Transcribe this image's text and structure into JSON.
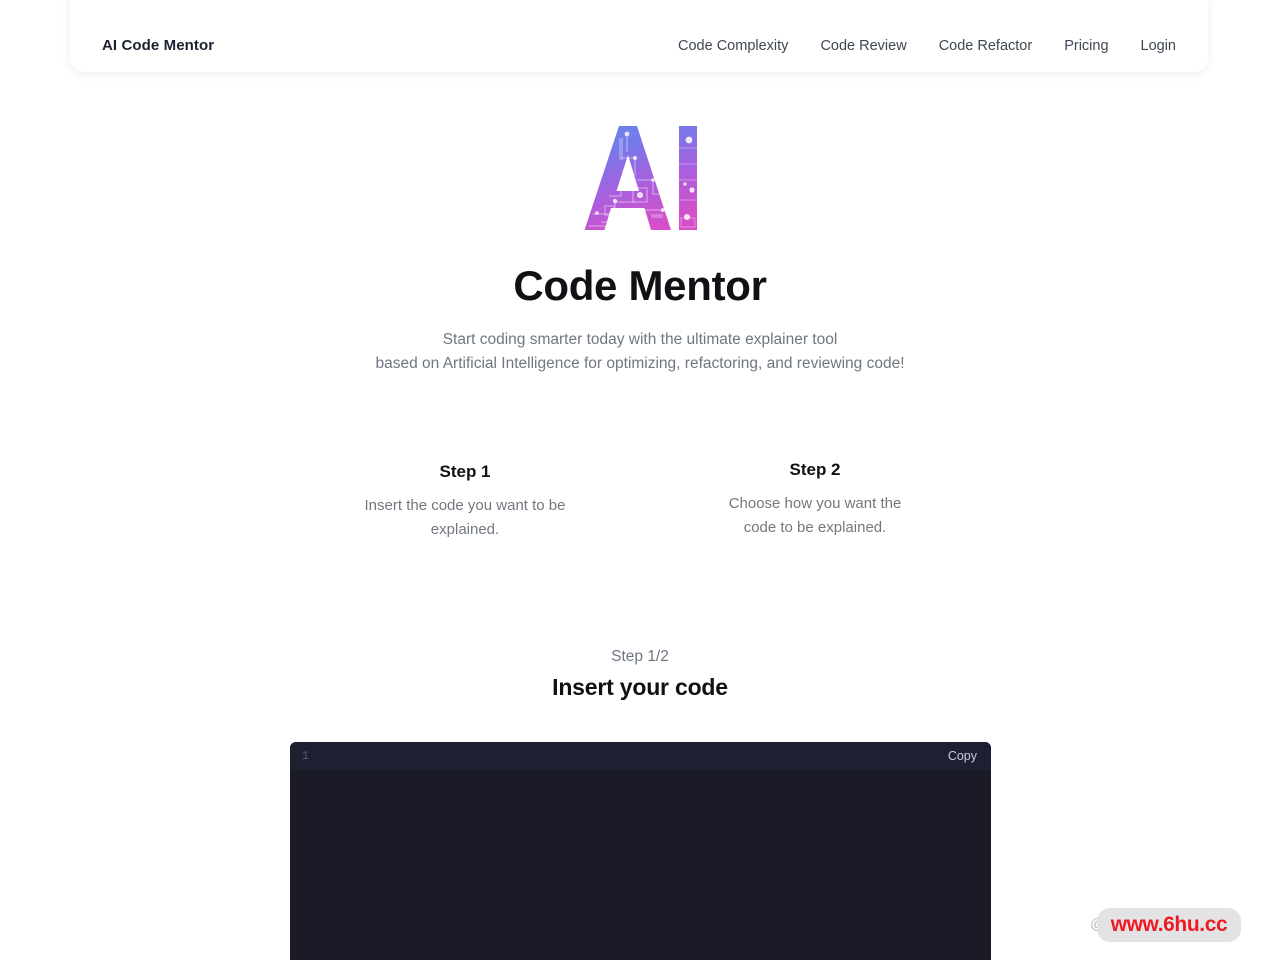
{
  "header": {
    "brand": "AI Code Mentor",
    "nav": [
      {
        "label": "Code Complexity",
        "name": "nav-code-complexity"
      },
      {
        "label": "Code Review",
        "name": "nav-code-review"
      },
      {
        "label": "Code Refactor",
        "name": "nav-code-refactor"
      },
      {
        "label": "Pricing",
        "name": "nav-pricing"
      },
      {
        "label": "Login",
        "name": "nav-login"
      }
    ]
  },
  "hero": {
    "logo_alt": "ai-logo",
    "title": "Code Mentor",
    "subtitle_line1": "Start coding smarter today with the ultimate explainer tool",
    "subtitle_line2": "based on Artificial Intelligence for optimizing, refactoring, and reviewing code!"
  },
  "steps": [
    {
      "title": "Step 1",
      "desc_line1": "Insert the code you want to be",
      "desc_line2": "explained."
    },
    {
      "title": "Step 2",
      "desc_line1": "Choose how you want the",
      "desc_line2": "code to be explained."
    }
  ],
  "current_step": {
    "label": "Step 1/2",
    "title": "Insert your code"
  },
  "editor": {
    "line_number": "1",
    "copy_label": "Copy",
    "content": ""
  },
  "watermark": {
    "ghost_text": "@f",
    "url": "www.6hu.cc"
  },
  "colors": {
    "page_bg": "#ffffff",
    "header_bg": "#ffffff",
    "text_dark": "#101114",
    "text_muted": "#6f7682",
    "editor_bg": "#1b1b27",
    "editor_topbar_bg": "#1d2030",
    "logo_gradient_start": "#5b8df0",
    "logo_gradient_mid": "#8b6ae0",
    "logo_gradient_end": "#d64fc8",
    "watermark_red": "#ed1c24"
  }
}
